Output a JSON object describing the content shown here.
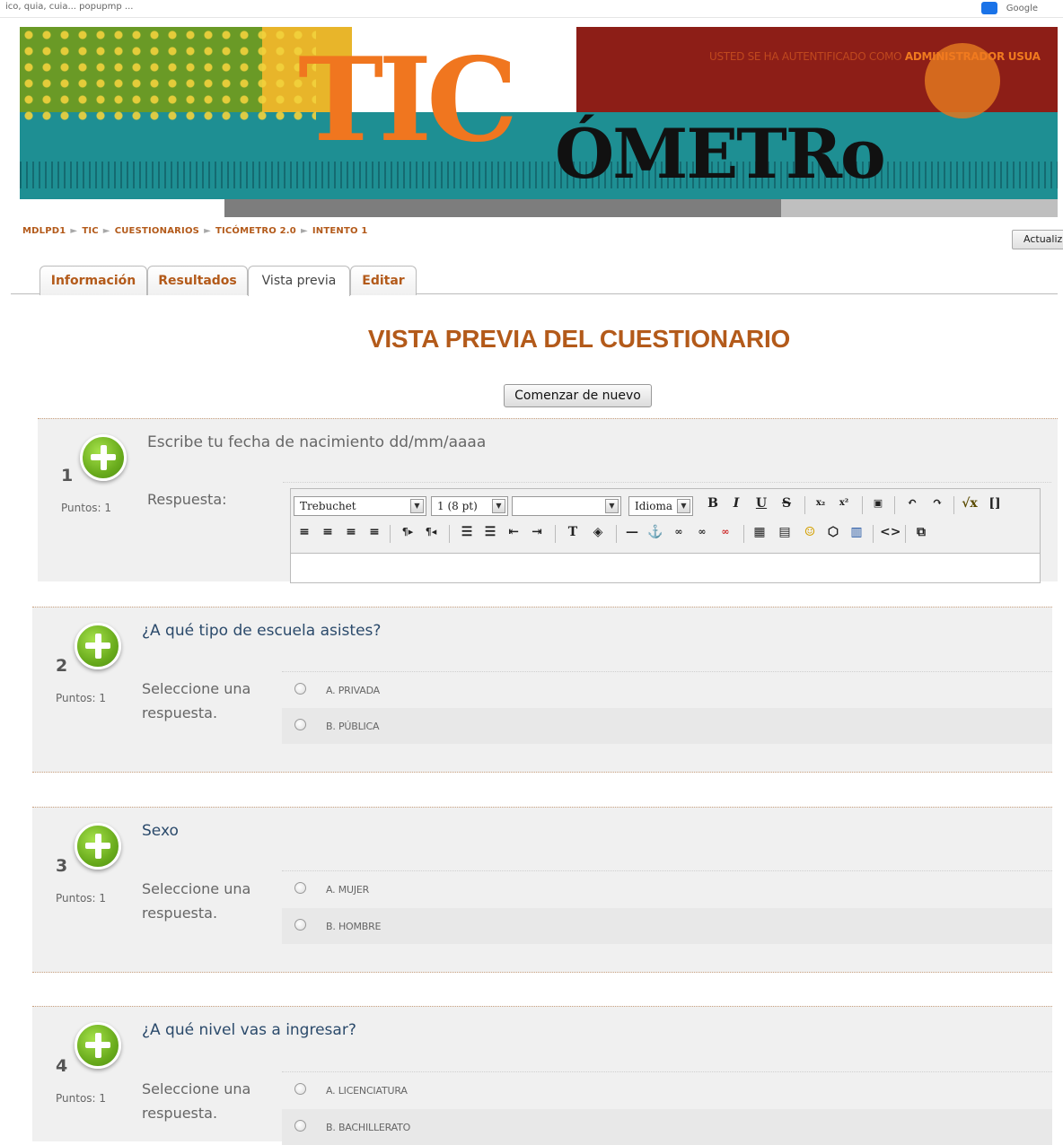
{
  "browser": {
    "url_text": "ico, quia, cuia... popupmp  ...",
    "search_text": "Google"
  },
  "banner": {
    "logo_tic": "TIC",
    "logo_metro": "ÓMETRo",
    "auth_prefix": "USTED SE HA AUTENTIFICADO COMO ",
    "auth_user": "ADMINISTRADOR USUA"
  },
  "breadcrumb": [
    "MDLPD1",
    "TIC",
    "CUESTIONARIOS",
    "TICÓMETRO 2.0",
    "INTENTO 1"
  ],
  "update_button": "Actualiz",
  "tabs": [
    {
      "label": "Información"
    },
    {
      "label": "Resultados"
    },
    {
      "label": "Vista previa",
      "active": true
    },
    {
      "label": "Editar"
    }
  ],
  "page_title": "VISTA PREVIA DEL CUESTIONARIO",
  "restart_button": "Comenzar de nuevo",
  "editor": {
    "font": "Trebuchet",
    "size": "1 (8 pt)",
    "format": "",
    "language": "Idioma"
  },
  "questions": [
    {
      "number": "1",
      "points": "Puntos: 1",
      "text": "Escribe tu fecha de nacimiento dd/mm/aaaa",
      "answer_label": "Respuesta:"
    },
    {
      "number": "2",
      "points": "Puntos: 1",
      "text": "¿A qué tipo de escuela asistes?",
      "select_label": "Seleccione una respuesta.",
      "options": [
        "A. PRIVADA",
        "B. PÚBLICA"
      ]
    },
    {
      "number": "3",
      "points": "Puntos: 1",
      "text": "Sexo",
      "select_label": "Seleccione una respuesta.",
      "options": [
        "A. MUJER",
        "B. HOMBRE"
      ]
    },
    {
      "number": "4",
      "points": "Puntos: 1",
      "text": "¿A qué nivel vas a ingresar?",
      "select_label": "Seleccione una respuesta.",
      "options": [
        "A. LICENCIATURA",
        "B. BACHILLERATO"
      ]
    }
  ]
}
